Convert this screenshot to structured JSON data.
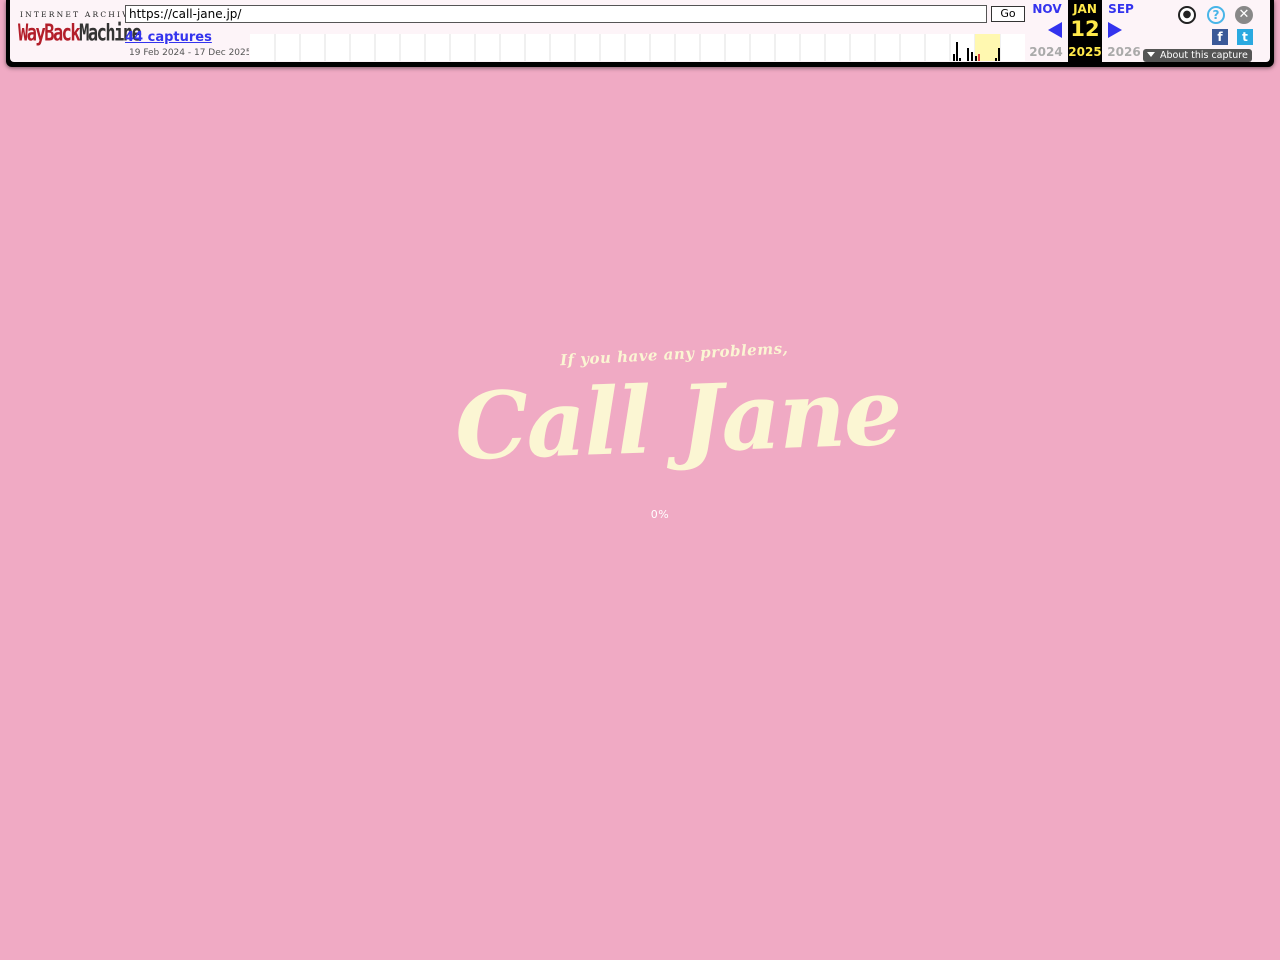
{
  "toolbar": {
    "logo_top": "INTERNET ARCHIVE",
    "logo_word1": "WayBack",
    "logo_word2": "Machine",
    "url": "https://call-jane.jp/",
    "go_label": "Go",
    "captures_label": "44 captures",
    "range_label": "19 Feb 2024 - 17 Dec 2025",
    "prev_month": "NOV",
    "current_month": "JAN",
    "next_month": "SEP",
    "current_day": "12",
    "prev_year": "2024",
    "current_year": "2025",
    "next_year": "2026",
    "about_label": "About this capture",
    "icons": {
      "account": "user-icon",
      "help": "help-icon",
      "close": "close-icon",
      "facebook": "facebook-icon",
      "twitter": "twitter-icon"
    },
    "highlight_color": "#ffe94a",
    "link_color": "#3333ee"
  },
  "page": {
    "tagline": "If you have any problems,",
    "logo": "Call Jane",
    "progress": "0%",
    "background_color": "#f0aac4",
    "text_color": "#fbf6d3"
  }
}
